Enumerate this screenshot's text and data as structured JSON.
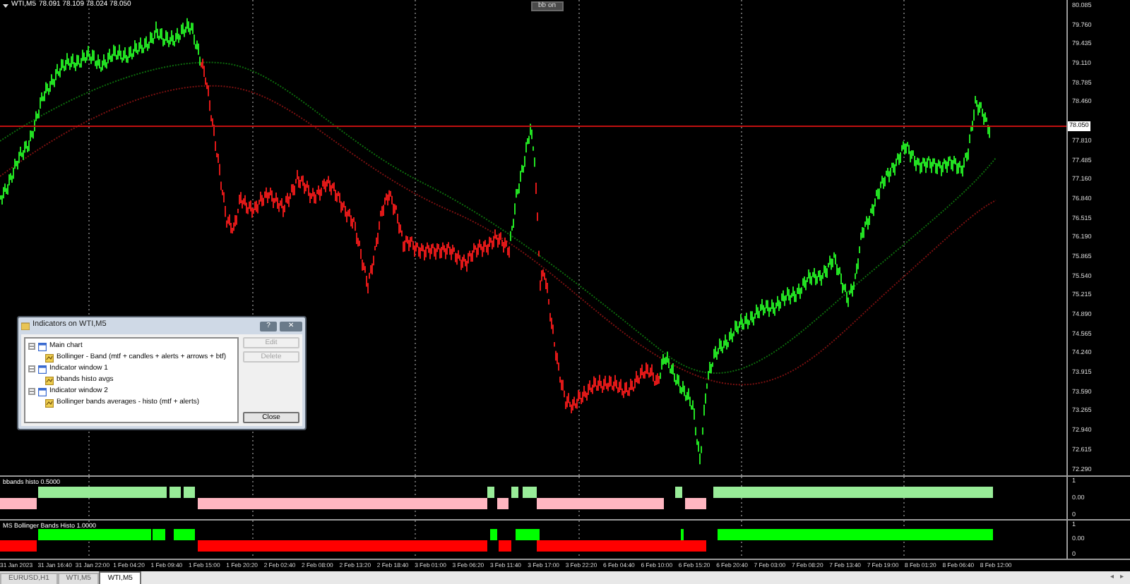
{
  "chart": {
    "symbol": "WTI,M5",
    "ohlc": "78.091 78.109 78.024 78.050",
    "toolbar_button": "bb on",
    "price_axis": [
      "80.085",
      "79.760",
      "79.435",
      "79.110",
      "78.785",
      "78.460",
      "77.810",
      "77.485",
      "77.160",
      "76.840",
      "76.515",
      "76.190",
      "75.865",
      "75.540",
      "75.215",
      "74.890",
      "74.565",
      "74.240",
      "73.915",
      "73.590",
      "73.265",
      "72.940",
      "72.615",
      "72.290"
    ],
    "current_price": "78.050"
  },
  "subwindows": [
    {
      "label": "bbands histo 0.5000",
      "axis": [
        "1",
        "0.00",
        "0"
      ]
    },
    {
      "label": "MS Bollinger Bands Histo 1.0000",
      "axis": [
        "1",
        "0.00",
        "0"
      ]
    }
  ],
  "time_axis": [
    "31 Jan 2023",
    "31 Jan 16:40",
    "31 Jan 22:00",
    "1 Feb 04:20",
    "1 Feb 09:40",
    "1 Feb 15:00",
    "1 Feb 20:20",
    "2 Feb 02:40",
    "2 Feb 08:00",
    "2 Feb 13:20",
    "2 Feb 18:40",
    "3 Feb 01:00",
    "3 Feb 06:20",
    "3 Feb 11:40",
    "3 Feb 17:00",
    "3 Feb 22:20",
    "6 Feb 04:40",
    "6 Feb 10:00",
    "6 Feb 15:20",
    "6 Feb 20:40",
    "7 Feb 03:00",
    "7 Feb 08:20",
    "7 Feb 13:40",
    "7 Feb 19:00",
    "8 Feb 01:20",
    "8 Feb 06:40",
    "8 Feb 12:00"
  ],
  "dialog": {
    "title": "Indicators on WTI,M5",
    "help": "?",
    "close": "✕",
    "tree": [
      {
        "label": "Main chart",
        "kind": "window",
        "expanded": true,
        "children": [
          {
            "label": "Bollinger - Band (mtf + candles + alerts + arrows + btf)",
            "kind": "indicator"
          }
        ]
      },
      {
        "label": "Indicator window 1",
        "kind": "window",
        "expanded": true,
        "children": [
          {
            "label": "bbands histo avgs",
            "kind": "indicator"
          }
        ]
      },
      {
        "label": "Indicator window 2",
        "kind": "window",
        "expanded": true,
        "children": [
          {
            "label": "Bollinger bands averages - histo (mtf + alerts)",
            "kind": "indicator"
          }
        ]
      }
    ],
    "buttons": [
      {
        "label": "Edit",
        "disabled": true
      },
      {
        "label": "Delete",
        "disabled": true
      },
      {
        "label": "Close",
        "disabled": false
      }
    ]
  },
  "tabs": [
    {
      "label": "EURUSD,H1",
      "selected": false
    },
    {
      "label": "WTI,M5",
      "selected": false
    },
    {
      "label": "WTI,M5",
      "selected": true
    }
  ],
  "scroll_buttons": [
    "◂",
    "▸"
  ]
}
